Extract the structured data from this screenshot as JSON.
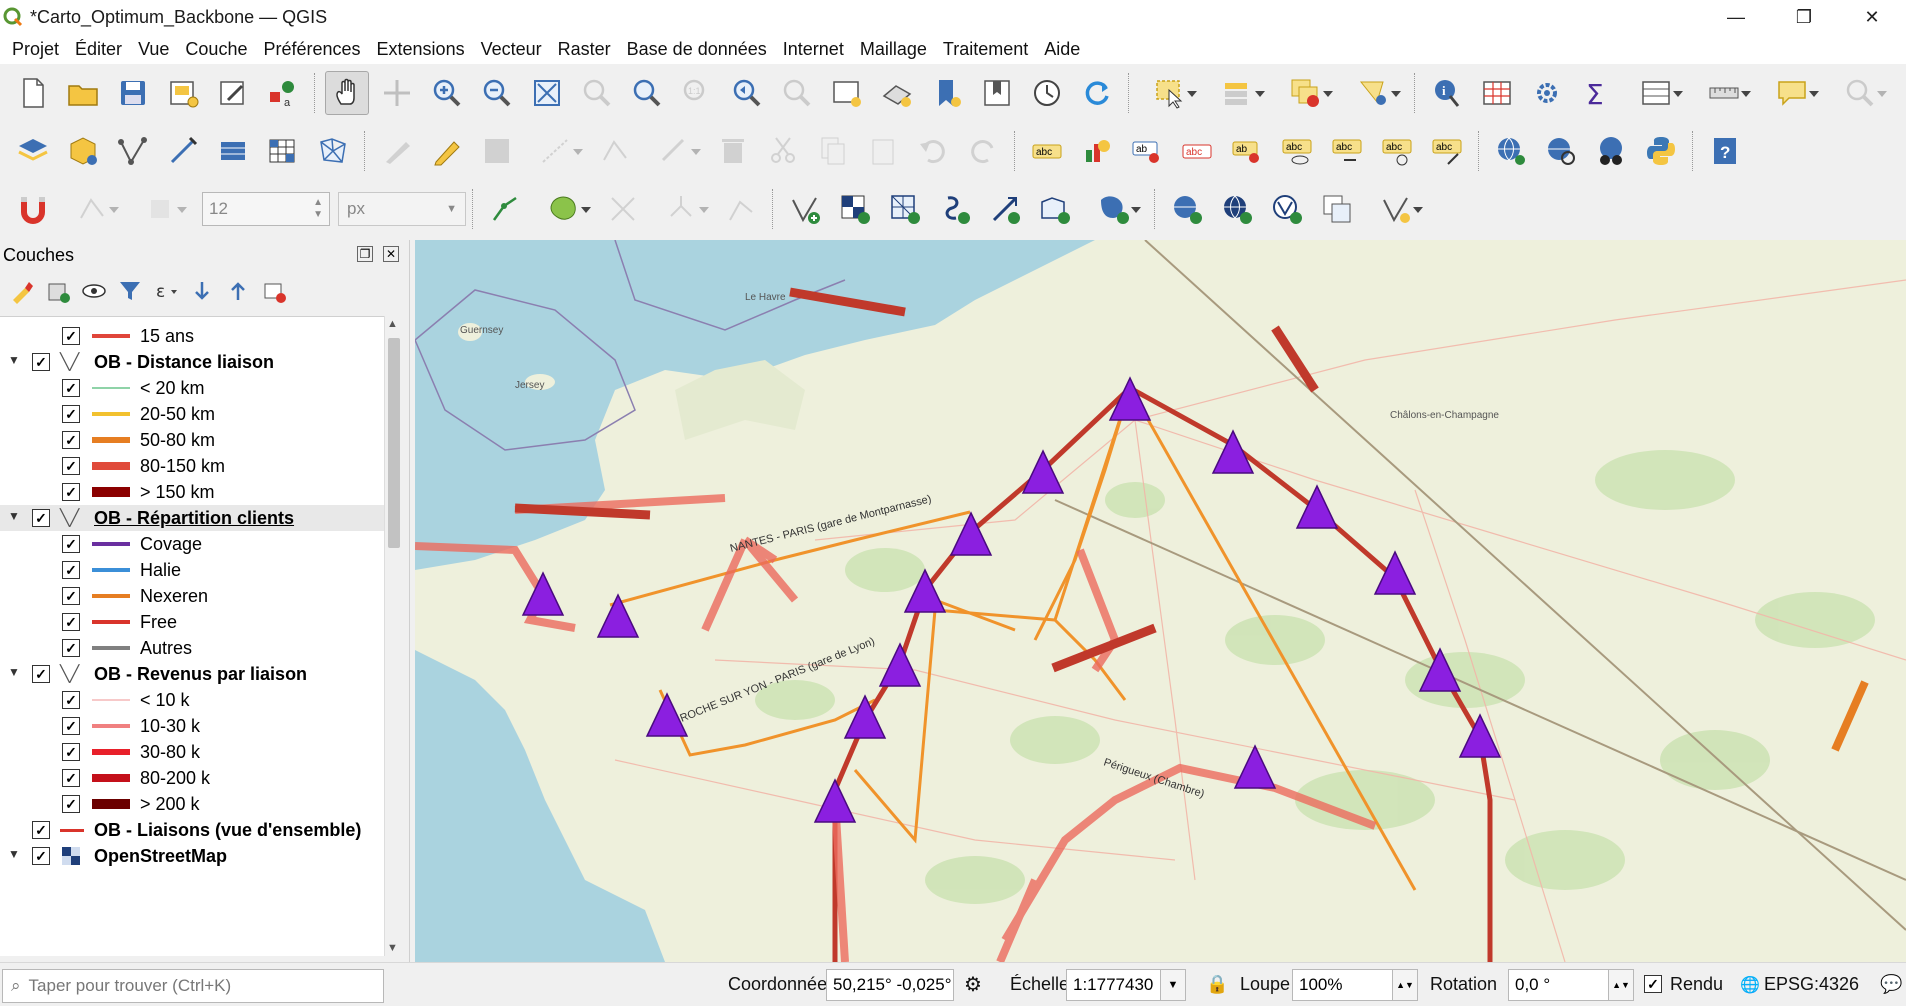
{
  "window": {
    "title": "*Carto_Optimum_Backbone — QGIS",
    "minimize": "—",
    "maximize": "❐",
    "close": "✕"
  },
  "menu": [
    "Projet",
    "Éditer",
    "Vue",
    "Couche",
    "Préférences",
    "Extensions",
    "Vecteur",
    "Raster",
    "Base de données",
    "Internet",
    "Maillage",
    "Traitement",
    "Aide"
  ],
  "digitizing": {
    "tolerance_value": "12",
    "tolerance_unit": "px"
  },
  "layers_panel": {
    "title": "Couches",
    "search_placeholder": "Taper pour trouver (Ctrl+K)",
    "rows": [
      {
        "type": "class",
        "label": "15 ans",
        "color": "#e0453a"
      },
      {
        "type": "layer",
        "label": "OB - Distance liaison"
      },
      {
        "type": "class",
        "label": "< 20 km",
        "color": "#8fd3a8"
      },
      {
        "type": "class",
        "label": "20-50 km",
        "color": "#f2c12e"
      },
      {
        "type": "class",
        "label": "50-80 km",
        "color": "#e67e22"
      },
      {
        "type": "class",
        "label": "80-150 km",
        "color": "#e04a3a"
      },
      {
        "type": "class",
        "label": "> 150 km",
        "color": "#8b0000"
      },
      {
        "type": "layer",
        "label": "OB - Répartition clients",
        "selected": true
      },
      {
        "type": "class",
        "label": "Covage",
        "color": "#6a2fa0"
      },
      {
        "type": "class",
        "label": "Halie",
        "color": "#3b8fd8"
      },
      {
        "type": "class",
        "label": "Nexeren",
        "color": "#e67e22"
      },
      {
        "type": "class",
        "label": "Free",
        "color": "#d9342b"
      },
      {
        "type": "class",
        "label": "Autres",
        "color": "#808080"
      },
      {
        "type": "layer",
        "label": "OB - Revenus par liaison"
      },
      {
        "type": "class",
        "label": "< 10 k",
        "color": "#f7c9c9"
      },
      {
        "type": "class",
        "label": "10-30 k",
        "color": "#f08080"
      },
      {
        "type": "class",
        "label": "30-80 k",
        "color": "#e8202a"
      },
      {
        "type": "class",
        "label": "80-200 k",
        "color": "#c4101a"
      },
      {
        "type": "class",
        "label": "> 200 k",
        "color": "#6b0000"
      },
      {
        "type": "layer_line",
        "label": "OB - Liaisons (vue d'ensemble)",
        "color": "#d9342b"
      },
      {
        "type": "layer_raster",
        "label": "OpenStreetMap"
      }
    ]
  },
  "map": {
    "labels": {
      "guernsey": "Guernsey",
      "jersey": "Jersey",
      "le_havre": "Le Havre",
      "nantes_paris": "NANTES - PARIS (gare de Montparnasse)",
      "laroche_paris": "LA ROCHE SUR YON - PARIS (gare de Lyon)",
      "perigueux": "Périgueux (Chambre)",
      "chalons": "Châlons-en-Champagne"
    },
    "node_color": "#8b1fe0",
    "link_colors": {
      "main": "#c0392b",
      "orange": "#f0932b",
      "light": "#ec6b5e"
    }
  },
  "statusbar": {
    "coord_label": "Coordonnée",
    "coord_value": "50,215° -0,025°",
    "scale_label": "Échelle",
    "scale_value": "1:1777430",
    "magnifier_label": "Loupe",
    "magnifier_value": "100%",
    "rotation_label": "Rotation",
    "rotation_value": "0,0 °",
    "render_label": "Rendu",
    "crs": "EPSG:4326"
  }
}
